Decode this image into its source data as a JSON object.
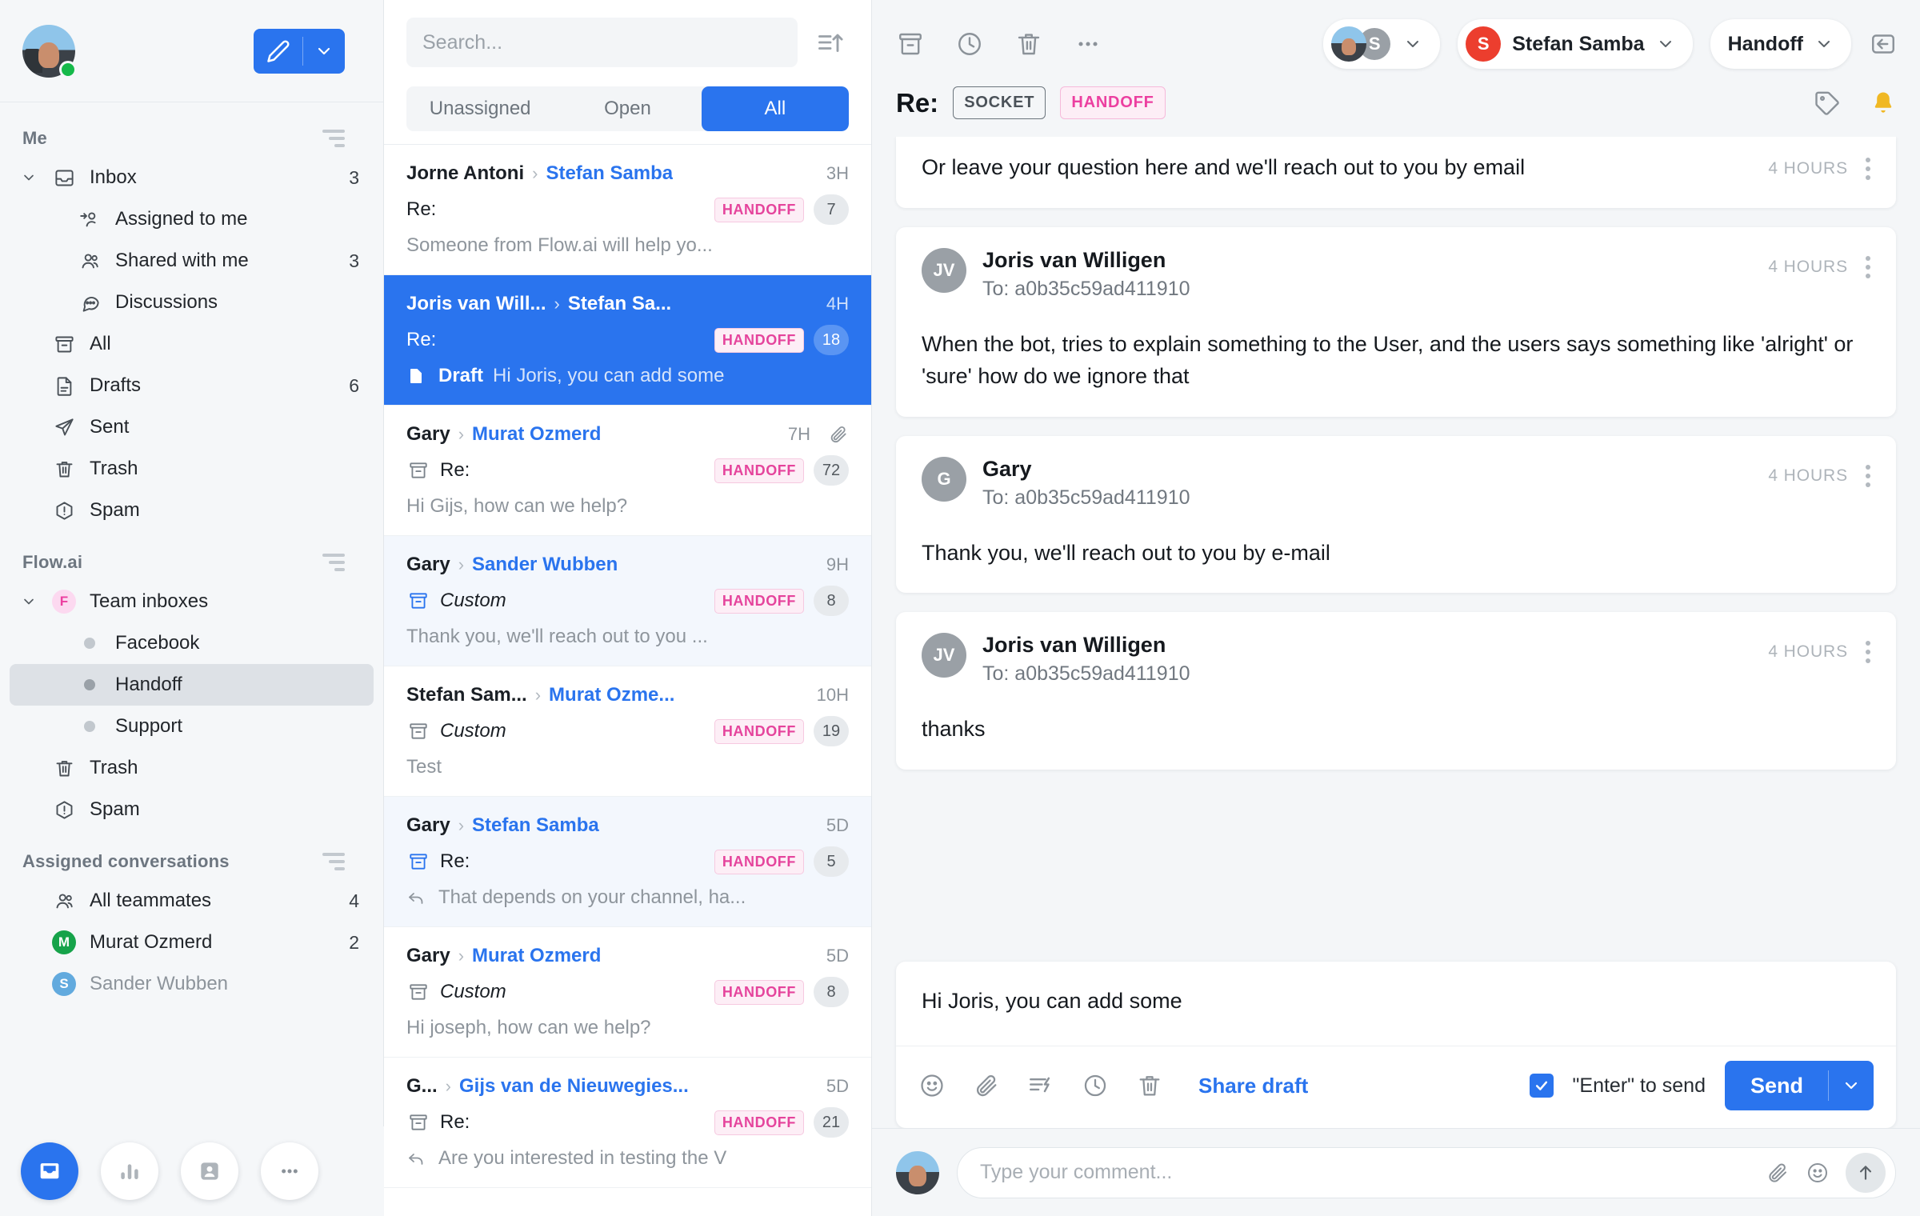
{
  "sidebar": {
    "compose_label": "Compose",
    "sections": [
      {
        "title": "Me"
      },
      {
        "title": "Flow.ai"
      },
      {
        "title": "Assigned conversations"
      }
    ],
    "me_items": [
      {
        "label": "Inbox",
        "count": "3",
        "icon": "inbox-icon"
      },
      {
        "label": "Assigned to me",
        "count": "",
        "icon": "assigned-user-icon"
      },
      {
        "label": "Shared with me",
        "count": "3",
        "icon": "users-icon"
      },
      {
        "label": "Discussions",
        "count": "",
        "icon": "chat-bubble-icon"
      },
      {
        "label": "All",
        "count": "",
        "icon": "archive-icon"
      },
      {
        "label": "Drafts",
        "count": "6",
        "icon": "document-icon"
      },
      {
        "label": "Sent",
        "count": "",
        "icon": "paper-plane-icon"
      },
      {
        "label": "Trash",
        "count": "",
        "icon": "trash-icon"
      },
      {
        "label": "Spam",
        "count": "",
        "icon": "alert-hexagon-icon"
      }
    ],
    "team_group_label": "Team inboxes",
    "team_group_avatar": "F",
    "team_items": [
      {
        "label": "Facebook",
        "count": ""
      },
      {
        "label": "Handoff",
        "count": ""
      },
      {
        "label": "Support",
        "count": ""
      }
    ],
    "team_extra": [
      {
        "label": "Trash",
        "count": "",
        "icon": "trash-icon"
      },
      {
        "label": "Spam",
        "count": "",
        "icon": "alert-hexagon-icon"
      }
    ],
    "assigned_items": [
      {
        "label": "All teammates",
        "count": "4",
        "avatar": "",
        "color": ""
      },
      {
        "label": "Murat Ozmerd",
        "count": "2",
        "avatar": "M",
        "color": "#16a34a"
      },
      {
        "label": "Sander Wubben",
        "count": "",
        "avatar": "S",
        "color": "#62aade"
      }
    ],
    "bottom_nav": [
      {
        "name": "inbox-icon",
        "active": true
      },
      {
        "name": "analytics-icon",
        "active": false
      },
      {
        "name": "contacts-icon",
        "active": false
      },
      {
        "name": "more-icon",
        "active": false
      }
    ]
  },
  "list": {
    "search": {
      "placeholder": "Search...",
      "value": ""
    },
    "sort_icon": "sort-ascending-icon",
    "filters": [
      {
        "label": "Unassigned",
        "selected": false
      },
      {
        "label": "Open",
        "selected": false
      },
      {
        "label": "All",
        "selected": true
      }
    ],
    "conversations": [
      {
        "from": "Jorne Antoni",
        "to": "Stefan Samba",
        "age": "3H",
        "subject": "Re:",
        "subject_italic": false,
        "tag": "HANDOFF",
        "count": "7",
        "preview": "Someone from Flow.ai will help yo...",
        "status_icon": "",
        "preview_icon": "",
        "draft": "",
        "attachment": false,
        "state": "normal"
      },
      {
        "from": "Joris van Will...",
        "to": "Stefan Sa...",
        "age": "4H",
        "subject": "Re:",
        "subject_italic": false,
        "tag": "HANDOFF",
        "count": "18",
        "preview": "Hi Joris, you can add some",
        "status_icon": "",
        "preview_icon": "document-icon",
        "draft": "Draft",
        "attachment": false,
        "state": "active"
      },
      {
        "from": "Gary",
        "to": "Murat Ozmerd",
        "age": "7H",
        "subject": "Re:",
        "subject_italic": false,
        "tag": "HANDOFF",
        "count": "72",
        "preview": "Hi Gijs, how can we help?",
        "status_icon": "archive-icon",
        "preview_icon": "",
        "draft": "",
        "attachment": true,
        "state": "normal"
      },
      {
        "from": "Gary",
        "to": "Sander Wubben",
        "age": "9H",
        "subject": "Custom",
        "subject_italic": true,
        "tag": "HANDOFF",
        "count": "8",
        "preview": "Thank you, we'll reach out to you ...",
        "status_icon": "archive-icon-blue",
        "preview_icon": "",
        "draft": "",
        "attachment": false,
        "state": "alt"
      },
      {
        "from": "Stefan Sam...",
        "to": "Murat Ozme...",
        "age": "10H",
        "subject": "Custom",
        "subject_italic": true,
        "tag": "HANDOFF",
        "count": "19",
        "preview": "Test",
        "status_icon": "archive-icon",
        "preview_icon": "",
        "draft": "",
        "attachment": false,
        "state": "normal"
      },
      {
        "from": "Gary",
        "to": "Stefan Samba",
        "age": "5D",
        "subject": "Re:",
        "subject_italic": false,
        "tag": "HANDOFF",
        "count": "5",
        "preview": "That depends on your channel, ha...",
        "status_icon": "archive-icon-blue",
        "preview_icon": "reply-icon",
        "draft": "",
        "attachment": false,
        "state": "alt"
      },
      {
        "from": "Gary",
        "to": "Murat Ozmerd",
        "age": "5D",
        "subject": "Custom",
        "subject_italic": true,
        "tag": "HANDOFF",
        "count": "8",
        "preview": "Hi joseph, how can we help?",
        "status_icon": "archive-icon",
        "preview_icon": "",
        "draft": "",
        "attachment": false,
        "state": "normal"
      },
      {
        "from": "G...",
        "to": "Gijs van de Nieuwegies...",
        "age": "5D",
        "subject": "Re:",
        "subject_italic": false,
        "tag": "HANDOFF",
        "count": "21",
        "preview": "Are you interested in testing the V",
        "status_icon": "archive-icon",
        "preview_icon": "reply-icon",
        "draft": "",
        "attachment": false,
        "state": "normal"
      }
    ]
  },
  "conversation": {
    "toolbar_icons": [
      "archive-icon",
      "snooze-clock-icon",
      "trash-icon",
      "more-icon"
    ],
    "participants_avatars": [
      "photo",
      "S"
    ],
    "assignee": {
      "initial": "S",
      "name": "Stefan Samba"
    },
    "inbox": {
      "label": "Handoff"
    },
    "collapse_icon": "collapse-panel-icon",
    "subject_prefix": "Re:",
    "chips": [
      {
        "label": "SOCKET",
        "style": "outline"
      },
      {
        "label": "HANDOFF",
        "style": "pink"
      }
    ],
    "right_icons": [
      "tag-icon",
      "bell-icon"
    ],
    "messages": [
      {
        "author": "",
        "initials": "",
        "to": "",
        "time": "4 HOURS",
        "body": "Or leave your question here and we'll reach out to you by email",
        "partial": true
      },
      {
        "author": "Joris van Willigen",
        "initials": "JV",
        "to": "To: a0b35c59ad411910",
        "time": "4 HOURS",
        "body": "When the bot, tries to explain something to the User, and the users says something like 'alright' or 'sure' how do we ignore that",
        "partial": false
      },
      {
        "author": "Gary",
        "initials": "G",
        "to": "To: a0b35c59ad411910",
        "time": "4 HOURS",
        "body": "Thank you, we'll reach out to you by e-mail",
        "partial": false
      },
      {
        "author": "Joris van Willigen",
        "initials": "JV",
        "to": "To: a0b35c59ad411910",
        "time": "4 HOURS",
        "body": "thanks",
        "partial": false
      }
    ],
    "composer": {
      "draft_text": "Hi Joris, you can add some",
      "icons": [
        "emoji-icon",
        "attachment-icon",
        "canned-response-icon",
        "schedule-clock-icon",
        "trash-icon"
      ],
      "share_label": "Share draft",
      "enter_to_send_label": "\"Enter\" to send",
      "enter_to_send_checked": true,
      "send_label": "Send"
    },
    "comment_bar": {
      "placeholder": "Type your comment...",
      "value": "",
      "icons": [
        "attachment-icon",
        "emoji-icon",
        "send-up-icon"
      ]
    }
  },
  "colors": {
    "accent": "#2a74ee",
    "tag_pink": "#ec3fa0",
    "assignee_red": "#ec3e2e",
    "presence_green": "#15b94a",
    "bell_yellow": "#f0b824"
  }
}
